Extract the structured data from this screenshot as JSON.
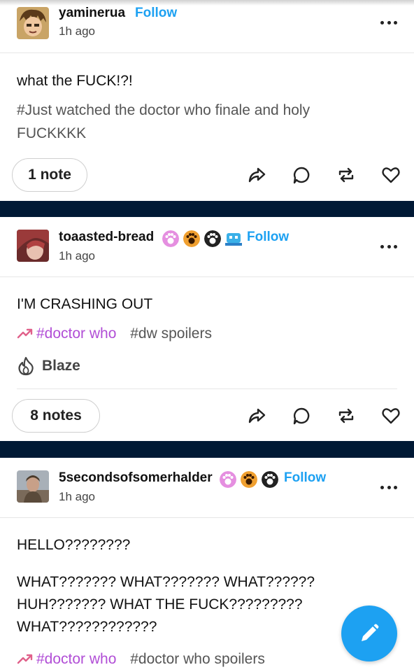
{
  "posts": [
    {
      "username": "yaminerua",
      "follow_label": "Follow",
      "time": "1h ago",
      "body": [
        "what the FUCK!?!"
      ],
      "tags_line1": "#Just watched the doctor who finale and holy",
      "tags_line2": "FUCKKKK",
      "notes": "1 note"
    },
    {
      "username": "toaasted-bread",
      "follow_label": "Follow",
      "time": "1h ago",
      "body": [
        "I'M CRASHING OUT"
      ],
      "trending_tag": "#doctor who",
      "tag": "#dw spoilers",
      "blaze_label": "Blaze",
      "notes": "8 notes"
    },
    {
      "username": "5secondsofsomerhalder",
      "follow_label": "Follow",
      "time": "1h ago",
      "body": [
        "HELLO????????",
        "WHAT??????? WHAT??????? WHAT??????",
        "HUH??????? WHAT THE FUCK?????????",
        "WHAT????????????"
      ],
      "trending_tag": "#doctor who",
      "tag": "#doctor who spoilers"
    }
  ],
  "colors": {
    "accent": "#1da1f2",
    "trending": "#b14ed6",
    "divider_band": "#001935"
  }
}
